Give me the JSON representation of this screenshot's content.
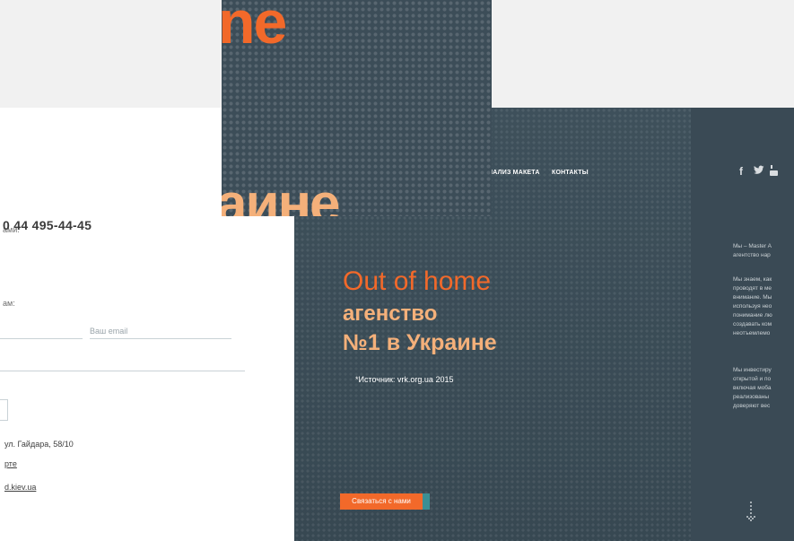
{
  "contact": {
    "call_label": "ами:",
    "phone": "0 44 495-44-45",
    "write_label": "ам:",
    "email_placeholder": "Ваш email",
    "address": "ул. Гайдара, 58/10",
    "map_link": "рте",
    "email_link": "d.kiev.ua"
  },
  "landing": {
    "nav_items": [
      "НАЛИЗ МАКЕТА",
      "КОНТАКТЫ"
    ],
    "social_icons": [
      "facebook-icon",
      "twitter-icon",
      "youtube-icon"
    ],
    "headline_1": "Out of home",
    "headline_2": "агенство",
    "headline_3": "№1 в Украине",
    "source": "*Источник: vrk.org.ua 2015",
    "cta_label": "Связаться с нами",
    "para_1": "Мы – Master A\nагентство нар",
    "para_2": "Мы знаем, как\nпроводят в ме\nвнимание. Мы\nиспользуя нео\nпонимание лю\nсоздавать ком\nнеотъемлемо",
    "para_3": "Мы инвестиру\nоткрытой и по\nвключая моба\nреализованы\nдоверяют вес"
  },
  "hero": {
    "word_top": "ne",
    "word_bottom": "аине"
  },
  "colors": {
    "accent": "#f2692a",
    "accent_light": "#f4b07a",
    "dark_bg": "#3b4c57",
    "cta_tail": "#3b8f93"
  }
}
